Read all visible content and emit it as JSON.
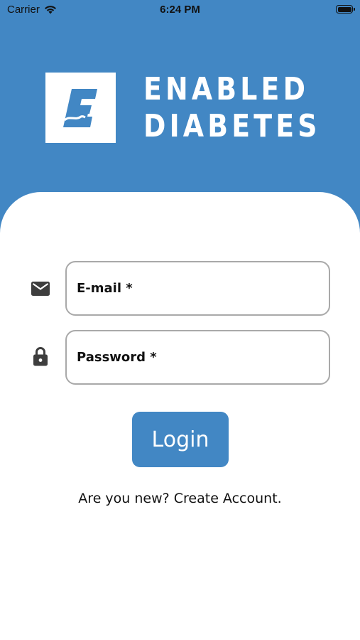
{
  "status_bar": {
    "carrier": "Carrier",
    "time": "6:24 PM",
    "icons": [
      "wifi-icon",
      "battery-icon"
    ]
  },
  "header": {
    "brand_logo_letter": "E",
    "brand_text": "ENABLED DIABETES",
    "color": "#4287c4"
  },
  "form": {
    "email": {
      "label": "E-mail *",
      "icon": "mail-icon"
    },
    "password": {
      "label": "Password *",
      "icon": "lock-icon"
    },
    "login_label": "Login"
  },
  "footer": {
    "create_account_text": "Are you new? Create Account."
  }
}
